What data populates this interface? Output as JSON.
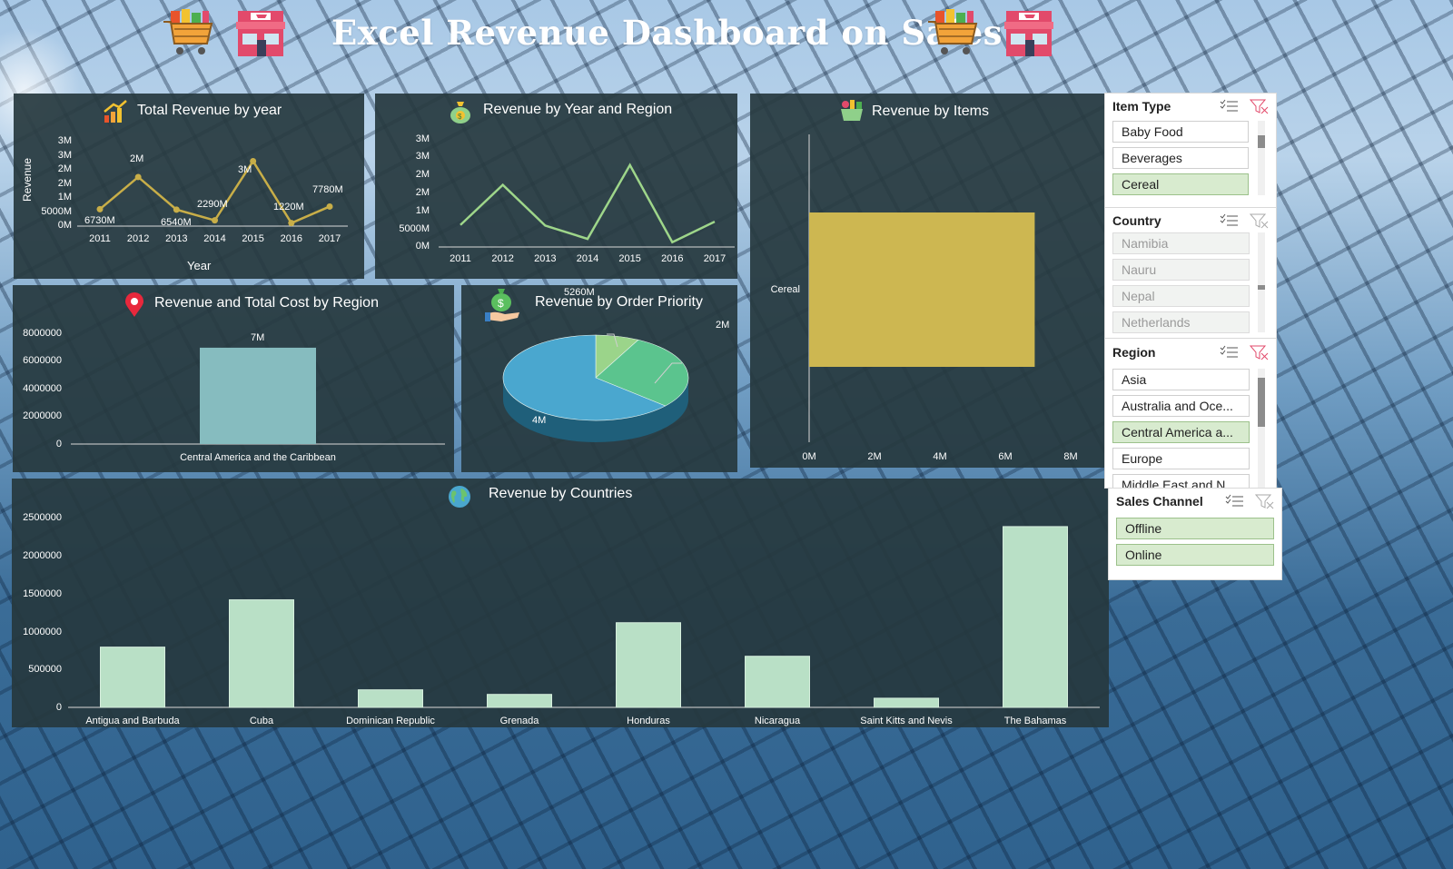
{
  "header": {
    "title": "Excel Revenue Dashboard on Sales",
    "icons": [
      "shopping-cart-icon",
      "store-icon",
      "shopping-cart-icon",
      "store-icon"
    ]
  },
  "colors": {
    "panel_bg": "#26383E",
    "line_gold": "#C8AE48",
    "line_green": "#9ED68A",
    "bar_teal": "#86BCBF",
    "bar_gold": "#CDB751",
    "pie_blue": "#4AA7CF",
    "pie_green": "#5BC48E",
    "pie_lightgreen": "#9BD48A",
    "country_bar": "#B9E0C6",
    "slicer_selected": "#D8EBCF"
  },
  "charts": {
    "revenue_by_year": {
      "title": "Total Revenue by year",
      "icon": "bar-chart-growth-icon",
      "ylabel": "Revenue",
      "xlabel": "Year",
      "yticks": [
        "3M",
        "3M",
        "2M",
        "2M",
        "1M",
        "5000M",
        "0M"
      ],
      "data_labels": [
        "6730M",
        "2M",
        "6540M",
        "2290M",
        "3M",
        "1220M",
        "7780M"
      ]
    },
    "year_region": {
      "title": "Revenue by Year and Region",
      "icon": "money-bag-icon",
      "yticks": [
        "3M",
        "3M",
        "2M",
        "2M",
        "1M",
        "5000M",
        "0M"
      ]
    },
    "items": {
      "title": "Revenue by Items",
      "icon": "grocery-basket-icon",
      "xticks": [
        "0M",
        "2M",
        "4M",
        "6M",
        "8M"
      ]
    },
    "region_cost": {
      "title": "Revenue and Total Cost by Region",
      "icon": "location-pin-icon",
      "yticks": [
        "8000000",
        "6000000",
        "4000000",
        "2000000",
        "0"
      ],
      "data_label": "7M"
    },
    "order_priority": {
      "title": "Revenue by Order Priority",
      "icon": "money-hand-icon",
      "labels": [
        "5260M",
        "2M",
        "4M"
      ]
    },
    "countries": {
      "title": "Revenue  by Countries",
      "icon": "globe-icon",
      "yticks": [
        "2500000",
        "2000000",
        "1500000",
        "1000000",
        "500000",
        "0"
      ]
    }
  },
  "chart_data": [
    {
      "type": "line",
      "title": "Total Revenue by year",
      "xlabel": "Year",
      "ylabel": "Revenue",
      "x": [
        "2011",
        "2012",
        "2013",
        "2014",
        "2015",
        "2016",
        "2017"
      ],
      "series": [
        {
          "values": [
            673000,
            1950000,
            654000,
            229000,
            2580000,
            122000,
            778000
          ]
        }
      ],
      "ylim": [
        0,
        3500000
      ]
    },
    {
      "type": "line",
      "title": "Revenue by Year and Region",
      "x": [
        "2011",
        "2012",
        "2013",
        "2014",
        "2015",
        "2016",
        "2017"
      ],
      "series": [
        {
          "values": [
            673000,
            1950000,
            654000,
            229000,
            2580000,
            122000,
            778000
          ]
        }
      ],
      "ylim": [
        0,
        3500000
      ]
    },
    {
      "type": "bar",
      "orientation": "horizontal",
      "title": "Revenue by Items",
      "categories": [
        "Cereal"
      ],
      "values": [
        6900000
      ],
      "xlim": [
        0,
        8000000
      ]
    },
    {
      "type": "bar",
      "title": "Revenue and Total Cost by Region",
      "categories": [
        "Central America and the Caribbean"
      ],
      "values": [
        6900000
      ],
      "ylim": [
        0,
        8000000
      ]
    },
    {
      "type": "pie",
      "title": "Revenue by Order Priority",
      "labels": [
        "4M",
        "2M",
        "5260M"
      ],
      "values": [
        4400000,
        2000000,
        526000
      ]
    },
    {
      "type": "bar",
      "title": "Revenue  by Countries",
      "categories": [
        "Antigua and Barbuda",
        "Cuba",
        "Dominican Republic",
        "Grenada",
        "Honduras",
        "Nicaragua",
        "Saint Kitts and Nevis",
        "The Bahamas"
      ],
      "values": [
        790000,
        1410000,
        230000,
        170000,
        1110000,
        670000,
        120000,
        2370000
      ],
      "ylim": [
        0,
        2500000
      ]
    }
  ],
  "slicers": {
    "item_type": {
      "title": "Item Type",
      "items": [
        "Baby Food",
        "Beverages",
        "Cereal"
      ],
      "selected": [
        "Cereal"
      ]
    },
    "country": {
      "title": "Country",
      "items": [
        "Namibia",
        "Nauru",
        "Nepal",
        "Netherlands"
      ]
    },
    "region": {
      "title": "Region",
      "items": [
        "Asia",
        "Australia and Oce...",
        "Central America a...",
        "Europe",
        "Middle East and N..."
      ],
      "selected": [
        "Central America a..."
      ]
    },
    "sales_channel": {
      "title": "Sales Channel",
      "items": [
        "Offline",
        "Online"
      ],
      "selected": [
        "Offline",
        "Online"
      ]
    }
  }
}
